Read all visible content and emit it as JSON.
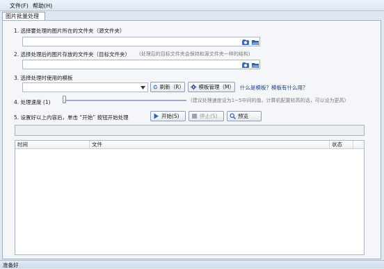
{
  "menu": {
    "file": "文件(F)",
    "help": "帮助(H)"
  },
  "tab": {
    "label": "图片批量处理"
  },
  "step1": {
    "label": "1. 选择要处理的图片所在的文件夹（源文件夹）",
    "value": ""
  },
  "step2": {
    "label": "2. 选择处理后的图片存放的文件夹（目标文件夹）",
    "hint": "(处理后的目标文件夹会保持和源文件夹一样的结构)",
    "value": ""
  },
  "step3": {
    "label": "3. 选择处理时使用的模板",
    "selected": "",
    "refresh_label": "刷新（R）",
    "manage_label": "模板管理（M）",
    "link_label": "什么是模板？模板有什么用？"
  },
  "step4": {
    "label": "4. 处理速度 (1)",
    "hint": "(建议处理速度设为1~5中间的值，计算机配置较高的话，可以设为更高)",
    "speed": 1
  },
  "step5": {
    "label": "5. 设置好以上内容后，单击 “开始” 按钮开始处理",
    "start_label": "开始(S)",
    "stop_label": "停止(S)",
    "preview_label": "预览"
  },
  "progress": {
    "value": 0
  },
  "table": {
    "columns": [
      "时间",
      "文件",
      "状态"
    ],
    "rows": []
  },
  "status": {
    "text": "准备好"
  },
  "colors": {
    "accent": "#1f3f8f",
    "panel": "#f4f6f9",
    "window_bg": "#dfe7f1"
  }
}
